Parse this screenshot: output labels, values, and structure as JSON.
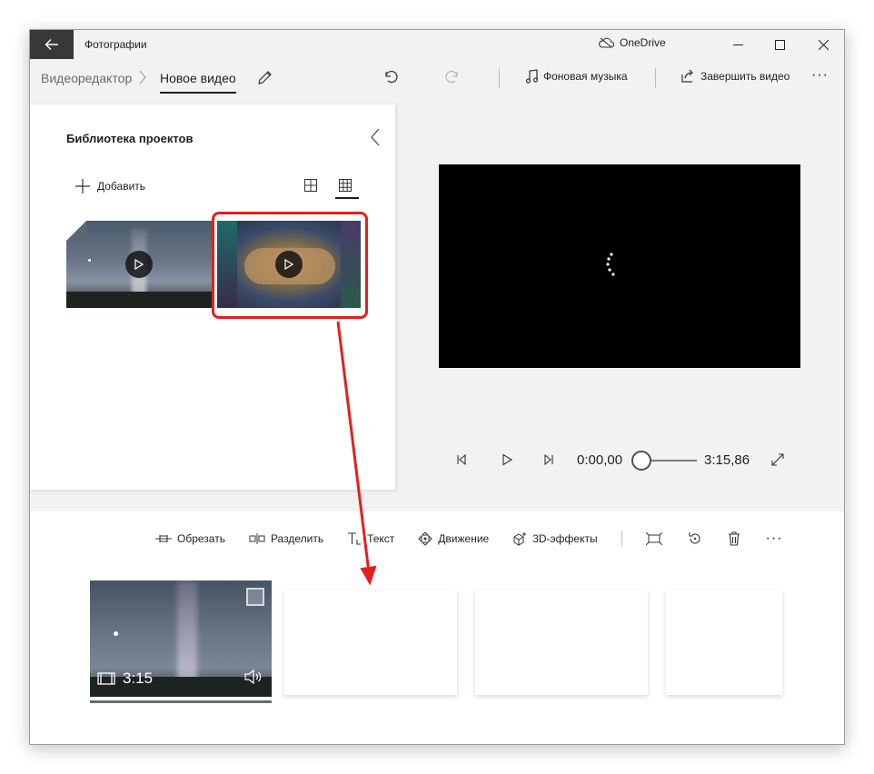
{
  "titlebar": {
    "app_title": "Фотографии",
    "cloud_label": "OneDrive"
  },
  "cmdbar": {
    "crumb_parent": "Видеоредактор",
    "crumb_current": "Новое видео",
    "bg_music": "Фоновая музыка",
    "finish_video": "Завершить видео",
    "more": "···"
  },
  "library": {
    "title": "Библиотека проектов",
    "add_label": "Добавить"
  },
  "player": {
    "current_time": "0:00,00",
    "total_time": "3:15,86"
  },
  "storyboard": {
    "tools": {
      "trim": "Обрезать",
      "split": "Разделить",
      "text": "Текст",
      "motion": "Движение",
      "effects3d": "3D-эффекты"
    },
    "more": "···",
    "clip": {
      "duration": "3:15"
    }
  },
  "colors": {
    "highlight": "#e41f1f",
    "titlebar_back": "#383838",
    "preview_bg": "#000000"
  }
}
